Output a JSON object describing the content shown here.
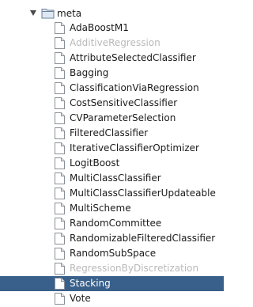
{
  "tree": {
    "folder": {
      "label": "meta",
      "expanded": true,
      "icon": "folder-icon"
    },
    "items": [
      {
        "label": "AdaBoostM1",
        "state": "normal"
      },
      {
        "label": "AdditiveRegression",
        "state": "disabled"
      },
      {
        "label": "AttributeSelectedClassifier",
        "state": "normal"
      },
      {
        "label": "Bagging",
        "state": "normal"
      },
      {
        "label": "ClassificationViaRegression",
        "state": "normal"
      },
      {
        "label": "CostSensitiveClassifier",
        "state": "normal"
      },
      {
        "label": "CVParameterSelection",
        "state": "normal"
      },
      {
        "label": "FilteredClassifier",
        "state": "normal"
      },
      {
        "label": "IterativeClassifierOptimizer",
        "state": "normal"
      },
      {
        "label": "LogitBoost",
        "state": "normal"
      },
      {
        "label": "MultiClassClassifier",
        "state": "normal"
      },
      {
        "label": "MultiClassClassifierUpdateable",
        "state": "normal"
      },
      {
        "label": "MultiScheme",
        "state": "normal"
      },
      {
        "label": "RandomCommittee",
        "state": "normal"
      },
      {
        "label": "RandomizableFilteredClassifier",
        "state": "normal"
      },
      {
        "label": "RandomSubSpace",
        "state": "normal"
      },
      {
        "label": "RegressionByDiscretization",
        "state": "disabled"
      },
      {
        "label": "Stacking",
        "state": "selected"
      },
      {
        "label": "Vote",
        "state": "normal"
      }
    ],
    "colors": {
      "selection": "#39608a",
      "disabled_text": "#b9b9b9",
      "text": "#1a1a1a"
    }
  }
}
